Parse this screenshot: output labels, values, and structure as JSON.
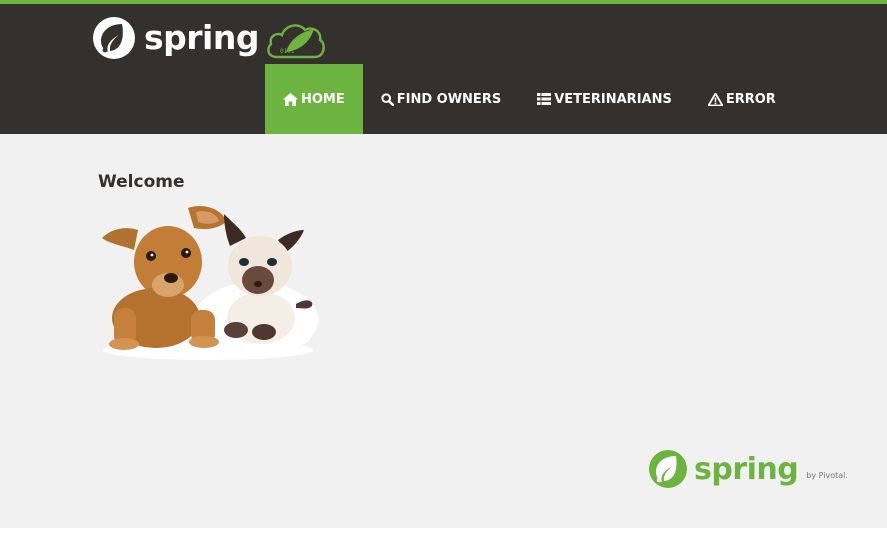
{
  "brand": {
    "name": "spring",
    "cloud_badge_text": "0101",
    "colors": {
      "green": "#6db33f",
      "header_bg": "#34302d",
      "page_bg": "#f1f1f1"
    }
  },
  "nav": {
    "items": [
      {
        "label": "HOME",
        "icon": "home-icon",
        "active": true
      },
      {
        "label": "FIND OWNERS",
        "icon": "search-icon",
        "active": false
      },
      {
        "label": "VETERINARIANS",
        "icon": "list-icon",
        "active": false
      },
      {
        "label": "ERROR",
        "icon": "warning-icon",
        "active": false
      }
    ]
  },
  "main": {
    "heading": "Welcome",
    "image": "pets-image"
  },
  "footer": {
    "brand": "spring",
    "by": "by Pivotal."
  }
}
